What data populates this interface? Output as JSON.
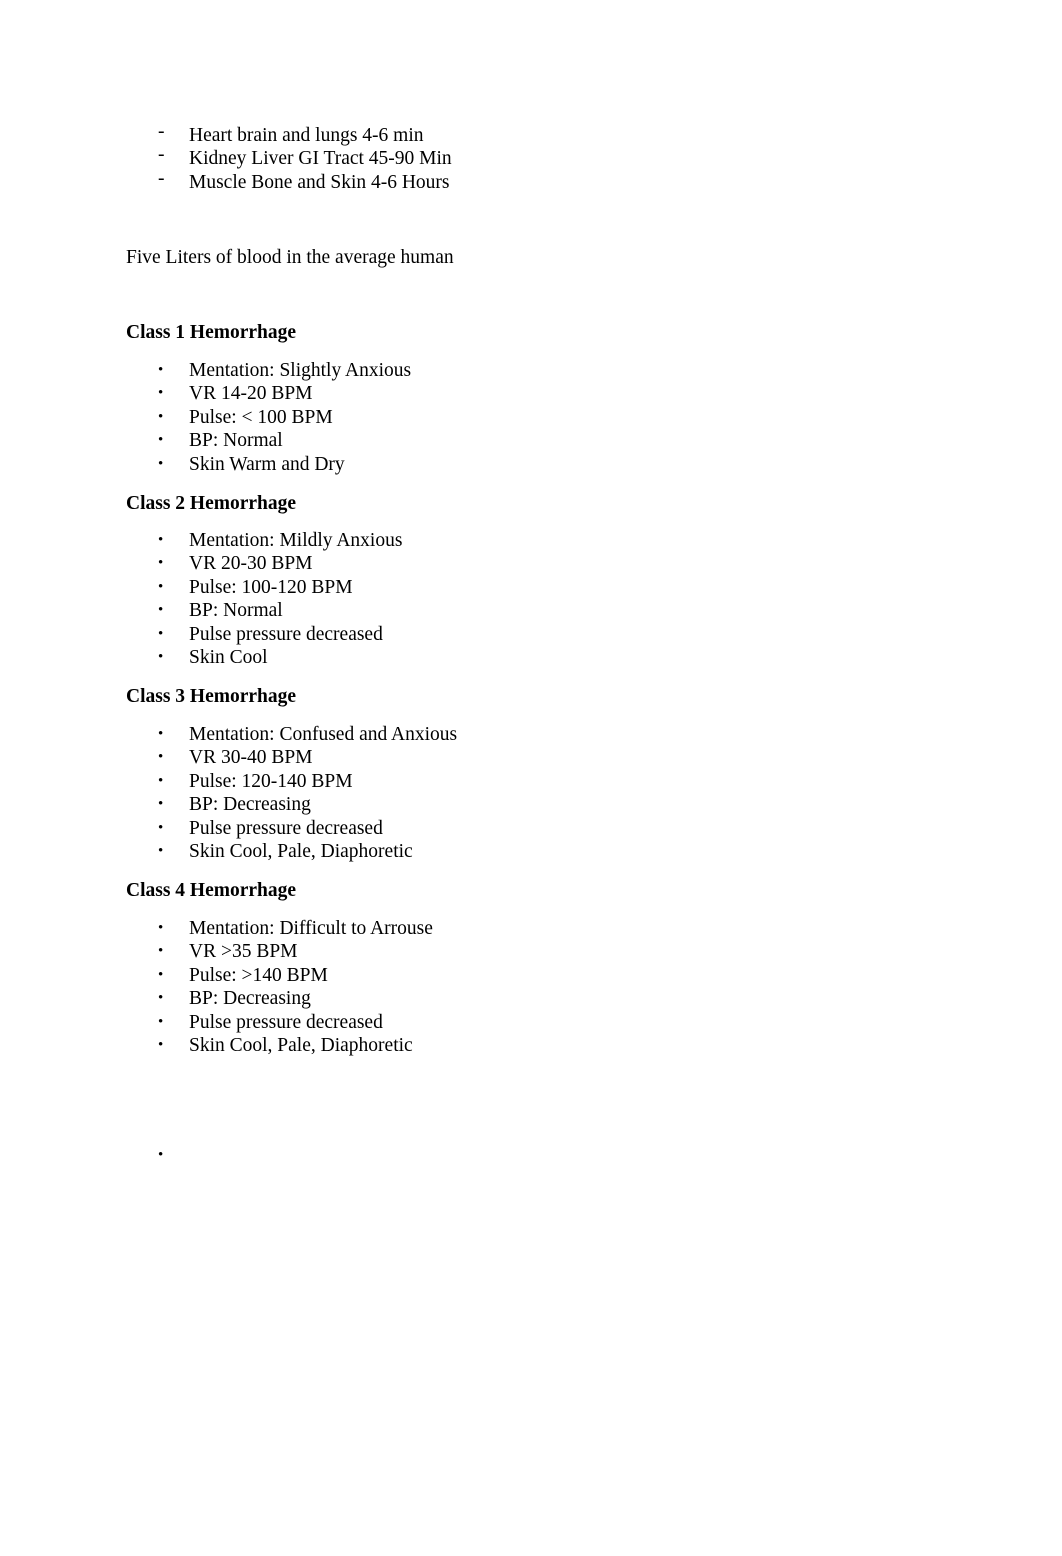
{
  "document": {
    "background_color": "#ffffff",
    "text_color": "#000000"
  },
  "perfusion_list": {
    "marker": "-",
    "items": [
      {
        "text": "Heart brain and lungs 4-6 min"
      },
      {
        "text": "Kidney Liver GI Tract 45-90 Min"
      },
      {
        "text": "Muscle Bone and Skin 4-6 Hours"
      }
    ]
  },
  "blood_volume_note": "Five Liters of blood in the average human",
  "bullet_marker": "•",
  "classes": [
    {
      "heading": "Class 1 Hemorrhage",
      "items": [
        "Mentation: Slightly Anxious",
        "VR 14-20 BPM",
        "Pulse: < 100 BPM",
        "BP: Normal",
        "Skin Warm and Dry"
      ]
    },
    {
      "heading": "Class 2 Hemorrhage",
      "items": [
        "Mentation: Mildly Anxious",
        "VR 20-30 BPM",
        "Pulse: 100-120 BPM",
        "BP: Normal",
        "Pulse pressure decreased",
        "Skin Cool"
      ]
    },
    {
      "heading": "Class 3 Hemorrhage",
      "items": [
        "Mentation: Confused and Anxious",
        "VR 30-40 BPM",
        "Pulse: 120-140 BPM",
        "BP: Decreasing",
        "Pulse pressure decreased",
        "Skin Cool, Pale, Diaphoretic"
      ]
    },
    {
      "heading": "Class 4 Hemorrhage",
      "items": [
        "Mentation: Difficult to Arrouse",
        "VR >35 BPM",
        "Pulse: >140 BPM",
        "BP: Decreasing",
        "Pulse pressure decreased",
        "Skin Cool, Pale, Diaphoretic"
      ]
    }
  ],
  "trailing_empty_bullet": {
    "marker": "•",
    "text": ""
  }
}
